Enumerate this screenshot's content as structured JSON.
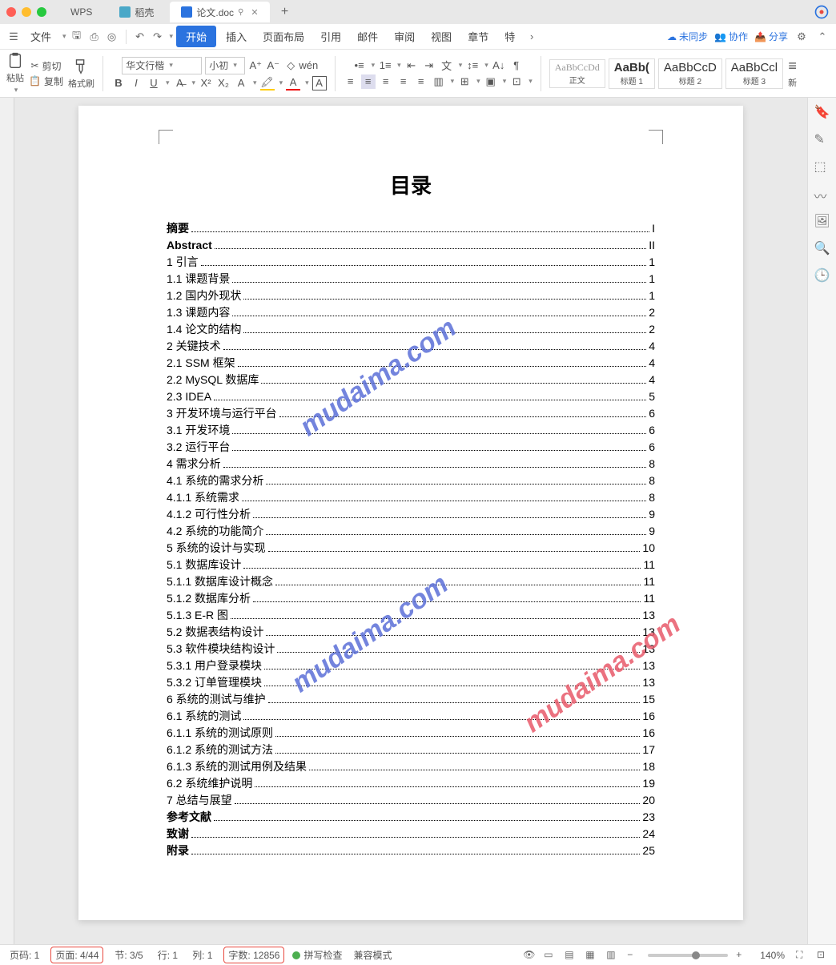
{
  "tabs": {
    "wps": "WPS",
    "daoke": "稻壳",
    "active": "论文.doc"
  },
  "menu": {
    "file": "文件",
    "start": "开始",
    "insert": "插入",
    "layout": "页面布局",
    "ref": "引用",
    "mail": "邮件",
    "review": "审阅",
    "view": "视图",
    "chapter": "章节",
    "special": "特",
    "unsync": "未同步",
    "collab": "协作",
    "share": "分享"
  },
  "toolbar": {
    "paste": "粘贴",
    "cut": "剪切",
    "copy": "复制",
    "fmtbrush": "格式刷",
    "font_name": "华文行楷",
    "font_size": "小初",
    "new_style": "新",
    "styles": {
      "body": {
        "preview": "AaBbCcDd",
        "label": "正文"
      },
      "h1": {
        "preview": "AaBb(",
        "label": "标题 1"
      },
      "h2": {
        "preview": "AaBbCcD",
        "label": "标题 2"
      },
      "h3": {
        "preview": "AaBbCcl",
        "label": "标题 3"
      }
    }
  },
  "doc": {
    "title": "目录",
    "toc": [
      {
        "label": "摘要",
        "page": "I",
        "bold": true
      },
      {
        "label": "Abstract",
        "page": "II",
        "bold": true
      },
      {
        "label": "1 引言",
        "page": "1"
      },
      {
        "label": "1.1  课题背景",
        "page": "1"
      },
      {
        "label": "1.2  国内外现状",
        "page": "1"
      },
      {
        "label": "1.3  课题内容",
        "page": "2"
      },
      {
        "label": "1.4  论文的结构",
        "page": "2"
      },
      {
        "label": "2  关键技术",
        "page": "4"
      },
      {
        "label": "2.1    SSM 框架",
        "page": "4"
      },
      {
        "label": "2.2    MySQL 数据库",
        "page": "4"
      },
      {
        "label": "2.3    IDEA",
        "page": "5"
      },
      {
        "label": "3  开发环境与运行平台",
        "page": "6"
      },
      {
        "label": "3.1  开发环境",
        "page": "6"
      },
      {
        "label": "3.2  运行平台",
        "page": "6"
      },
      {
        "label": "4  需求分析",
        "page": "8"
      },
      {
        "label": "4.1  系统的需求分析",
        "page": "8"
      },
      {
        "label": "4.1.1  系统需求",
        "page": "8"
      },
      {
        "label": "4.1.2  可行性分析",
        "page": "9"
      },
      {
        "label": "4.2  系统的功能简介",
        "page": "9"
      },
      {
        "label": "5  系统的设计与实现",
        "page": "10"
      },
      {
        "label": "5.1  数据库设计",
        "page": "11"
      },
      {
        "label": "5.1.1  数据库设计概念",
        "page": "11"
      },
      {
        "label": "5.1.2  数据库分析",
        "page": "11"
      },
      {
        "label": "5.1.3    E-R 图",
        "page": "13"
      },
      {
        "label": "5.2  数据表结构设计",
        "page": "13"
      },
      {
        "label": "5.3  软件模块结构设计",
        "page": "13"
      },
      {
        "label": "5.3.1  用户登录模块",
        "page": "13"
      },
      {
        "label": "5.3.2  订单管理模块",
        "page": "13"
      },
      {
        "label": "6  系统的测试与维护",
        "page": "15"
      },
      {
        "label": "6.1  系统的测试",
        "page": "16"
      },
      {
        "label": "6.1.1  系统的测试原则",
        "page": "16"
      },
      {
        "label": "6.1.2  系统的测试方法",
        "page": "17"
      },
      {
        "label": "6.1.3  系统的测试用例及结果",
        "page": "18"
      },
      {
        "label": "6.2  系统维护说明",
        "page": "19"
      },
      {
        "label": "7  总结与展望",
        "page": "20"
      },
      {
        "label": "参考文献",
        "page": "23",
        "bold": true
      },
      {
        "label": "致谢",
        "page": "24",
        "bold": true
      },
      {
        "label": "附录",
        "page": "25",
        "bold": true
      }
    ]
  },
  "watermark": "mudaima.com",
  "status": {
    "page_no": "页码: 1",
    "page": "页面: 4/44",
    "section": "节: 3/5",
    "row": "行: 1",
    "col": "列: 1",
    "words": "字数: 12856",
    "spell": "拼写检查",
    "compat": "兼容模式",
    "zoom": "140%"
  }
}
